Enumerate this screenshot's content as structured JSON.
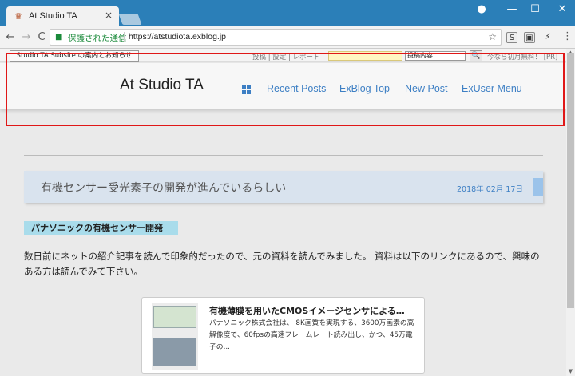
{
  "browser": {
    "tab_title": "At Studio TA",
    "tab_close": "×",
    "window_controls": [
      "●",
      "—",
      "☐",
      "✕"
    ],
    "nav": {
      "back": "←",
      "forward": "→",
      "reload": "C"
    },
    "secure_label": "保護された通信",
    "url": "https://atstudiota.exblog.jp",
    "bookmark_star": "☆",
    "extensions": [
      "S",
      "▣",
      "⚡"
    ],
    "menu": "⋮"
  },
  "exblog_bar": {
    "subsite_button": "Studio TA Subsite の案内とお知らせ",
    "links": "投稿 | 設定 | レポート",
    "search_scope": "投稿内容",
    "search_icon": "🔍",
    "promo": "今なら初月無料！ [PR]"
  },
  "header": {
    "site_title": "At Studio TA",
    "nav_items": [
      "Recent Posts",
      "ExBlog Top",
      "New Post",
      "ExUser Menu"
    ]
  },
  "post": {
    "title": "有機センサー受光素子の開発が進んでいるらしい",
    "date": "2018年 02月 17日",
    "section_label": "パナソニックの有機センサー開発",
    "body": "数日前にネットの紹介記事を読んで印象的だったので、元の資料を読んでみました。 資料は以下のリンクにあるので、興味のある方は読んでみて下さい。"
  },
  "link_card": {
    "title": "有機薄膜を用いたCMOSイメージセンサによる…",
    "description": "パナソニック株式会社は、 8K画質を実現する、3600万画素の高解像度で、60fpsの高速フレームレート読み出し、かつ、45万電子の..."
  },
  "colors": {
    "title_bar": "#2b7fb8",
    "accent_link": "#3d7fc4",
    "highlight_box": "#e01818",
    "section_label_bg": "#a9dceb"
  }
}
